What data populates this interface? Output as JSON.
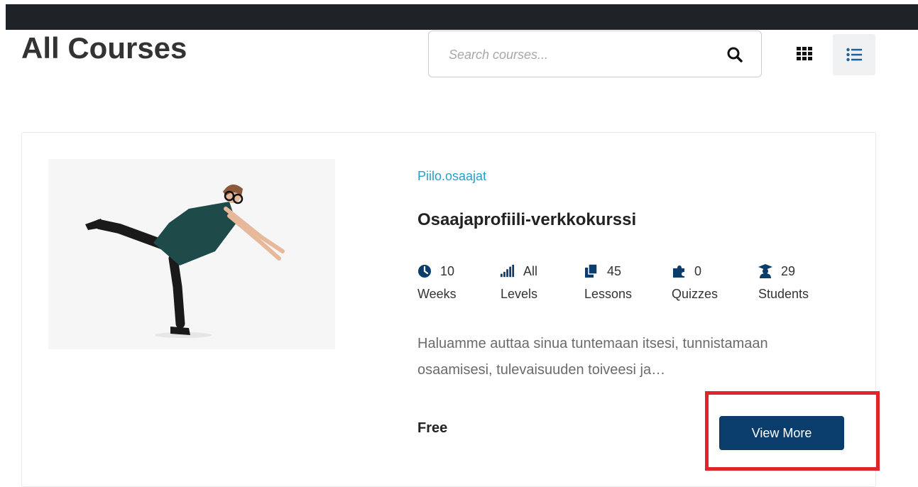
{
  "header": {
    "title": "All Courses"
  },
  "search": {
    "placeholder": "Search courses..."
  },
  "view_toggle": {
    "grid_icon": "grid-icon",
    "list_icon": "list-icon"
  },
  "course": {
    "category": "Piilo.osaajat",
    "title": "Osaajaprofiili-verkkokurssi",
    "meta": [
      {
        "icon": "clock-icon",
        "value": "10",
        "unit": "Weeks"
      },
      {
        "icon": "signal-bars-icon",
        "value": "All",
        "unit": "Levels"
      },
      {
        "icon": "copy-icon",
        "value": "45",
        "unit": "Lessons"
      },
      {
        "icon": "puzzle-icon",
        "value": "0",
        "unit": "Quizzes"
      },
      {
        "icon": "graduate-icon",
        "value": "29",
        "unit": "Students"
      }
    ],
    "excerpt": "Haluamme auttaa sinua tuntemaan itsesi, tunnistamaan osaamisesi, tulevaisuuden toiveesi ja…",
    "price": "Free",
    "button_label": "View More"
  },
  "colors": {
    "accent": "#0a3d6b",
    "category_link": "#2a9fc9",
    "highlight": "#e0242c",
    "topbar": "#1f2328"
  }
}
